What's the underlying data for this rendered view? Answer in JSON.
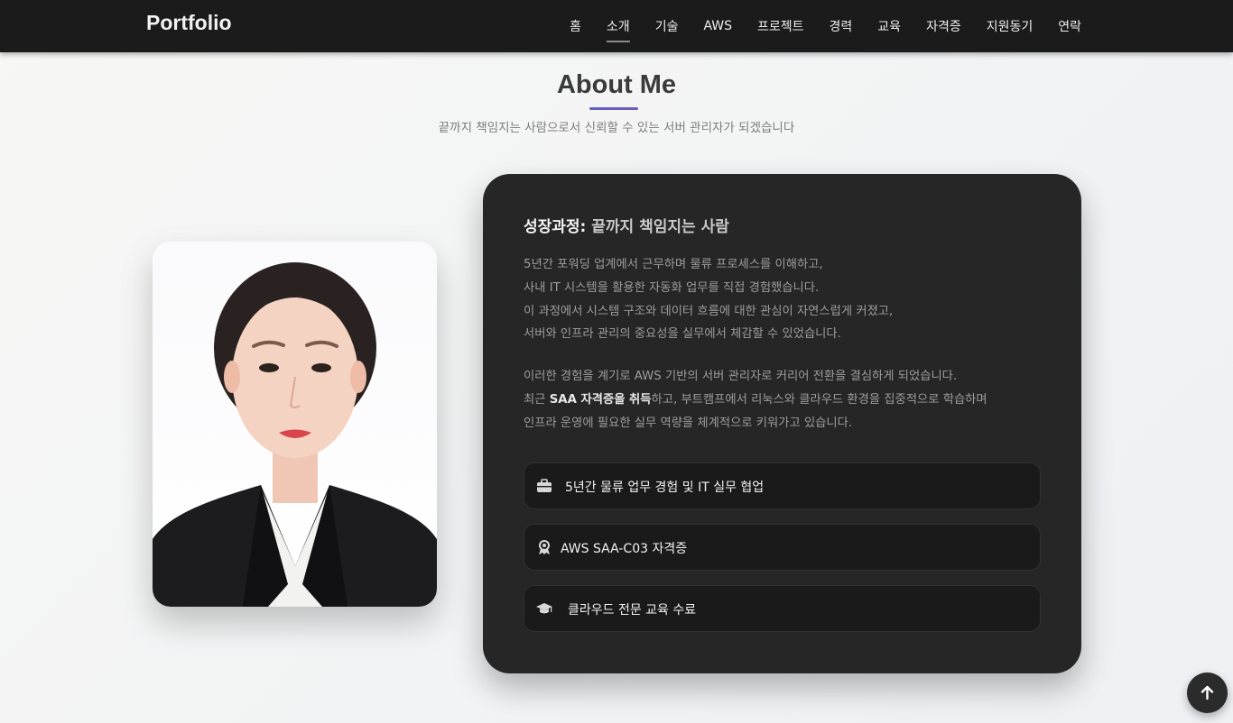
{
  "nav": {
    "brand": "Portfolio",
    "items": [
      {
        "label": "홈"
      },
      {
        "label": "소개"
      },
      {
        "label": "기술"
      },
      {
        "label": "AWS"
      },
      {
        "label": "프로젝트"
      },
      {
        "label": "경력"
      },
      {
        "label": "교육"
      },
      {
        "label": "자격증"
      },
      {
        "label": "지원동기"
      },
      {
        "label": "연락"
      }
    ],
    "active": "소개"
  },
  "about": {
    "title": "About Me",
    "subtitle": "끝까지 책임지는 사람으로서 신뢰할 수 있는 서버 관리자가 되겠습니다",
    "photo_icon": "profile-photo",
    "card": {
      "heading_prefix": "성장과정: ",
      "heading_accent": "끝까지 책임지는 사람",
      "paragraph1": [
        "5년간 포워딩 업계에서 근무하며 물류 프로세스를 이해하고,",
        "사내 IT 시스템을 활용한 자동화 업무를 직접 경험했습니다.",
        "이 과정에서 시스템 구조와 데이터 흐름에 대한 관심이 자연스럽게 커졌고,",
        "서버와 인프라 관리의 중요성을 실무에서 체감할 수 있었습니다."
      ],
      "paragraph2": {
        "line1": "이러한 경험을 계기로 AWS 기반의 서버 관리자로 커리어 전환을 결심하게 되었습니다.",
        "line2_prefix": "최근 ",
        "line2_bold": "SAA 자격증을 취득",
        "line2_suffix": "하고, 부트캠프에서 리눅스와 클라우드 환경을 집중적으로 학습하며",
        "line3": "인프라 운영에 필요한 실무 역량을 체계적으로 키워가고 있습니다."
      },
      "features": [
        {
          "icon": "briefcase-icon",
          "label": "5년간 물류 업무 경험 및 IT 실무 협업"
        },
        {
          "icon": "award-icon",
          "label": "AWS SAA-C03 자격증"
        },
        {
          "icon": "graduation-cap-icon",
          "label": "클라우드 전문 교육 수료"
        }
      ]
    }
  },
  "scroll_top": {
    "icon": "arrow-up-icon"
  },
  "colors": {
    "nav_bg": "#1b1b1b",
    "card_bg": "#262626",
    "feature_bg": "#1a1a1a",
    "title_underline": "#5a60c8"
  }
}
